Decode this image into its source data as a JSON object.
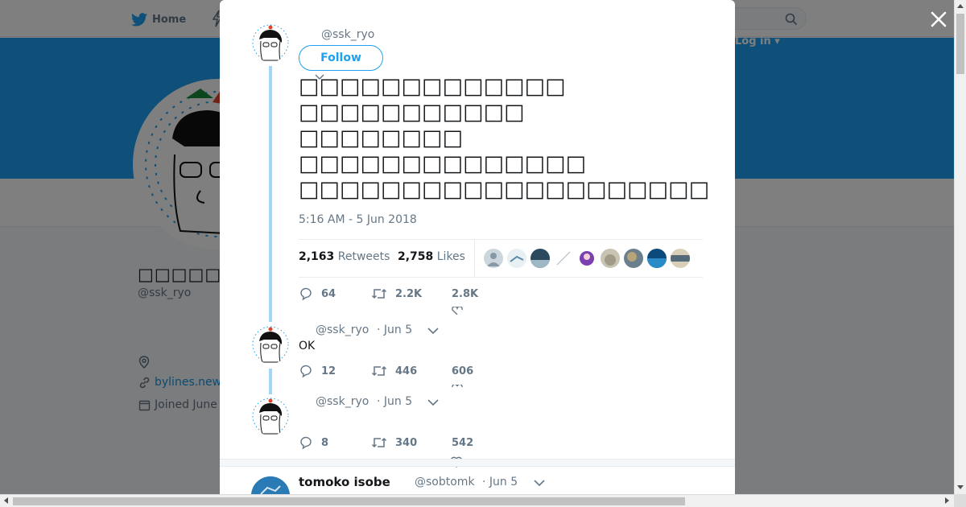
{
  "background": {
    "nav": {
      "home_label": "Home",
      "login_label": "Log in ▾"
    },
    "profile": {
      "name": "□□□□□□",
      "handle": "@ssk_ryo",
      "link_text": "bylines.new",
      "joined_text": "Joined June"
    },
    "colors": {
      "banner": "#1da1f2",
      "link": "#1b95e0"
    }
  },
  "modal": {
    "main_tweet": {
      "handle": "@ssk_ryo",
      "follow_label": "Follow",
      "text_lines": [
        "□□□□□□□□□□□□□",
        "□□□□□□□□□□□",
        "□□□□□□□□",
        "□□□□□□□□□□□□□□",
        "□□□□□□□□□□□□□□□□□□□□□□□□□□□□□□"
      ],
      "timestamp": "5:16 AM - 5 Jun 2018",
      "retweets_count": "2,163",
      "retweets_label": "Retweets",
      "likes_count": "2,758",
      "likes_label": "Likes",
      "reply_count": "64",
      "retweet_count_short": "2.2K",
      "like_count_short": "2.8K"
    },
    "replies": [
      {
        "handle": "@ssk_ryo",
        "date": "· Jun 5",
        "text": "OK",
        "reply_count": "12",
        "retweet_count": "446",
        "like_count": "606"
      },
      {
        "handle": "@ssk_ryo",
        "date": "· Jun 5",
        "text": "",
        "reply_count": "8",
        "retweet_count": "340",
        "like_count": "542"
      }
    ],
    "next_tweet": {
      "name": "tomoko isobe",
      "handle": "@sobtomk",
      "date": "· Jun 5"
    }
  },
  "icons": [
    "twitter-bird-icon",
    "lightning-icon",
    "search-icon",
    "close-icon",
    "location-icon",
    "link-icon",
    "calendar-icon",
    "reply-icon",
    "retweet-icon",
    "heart-icon",
    "chevron-down-icon"
  ]
}
